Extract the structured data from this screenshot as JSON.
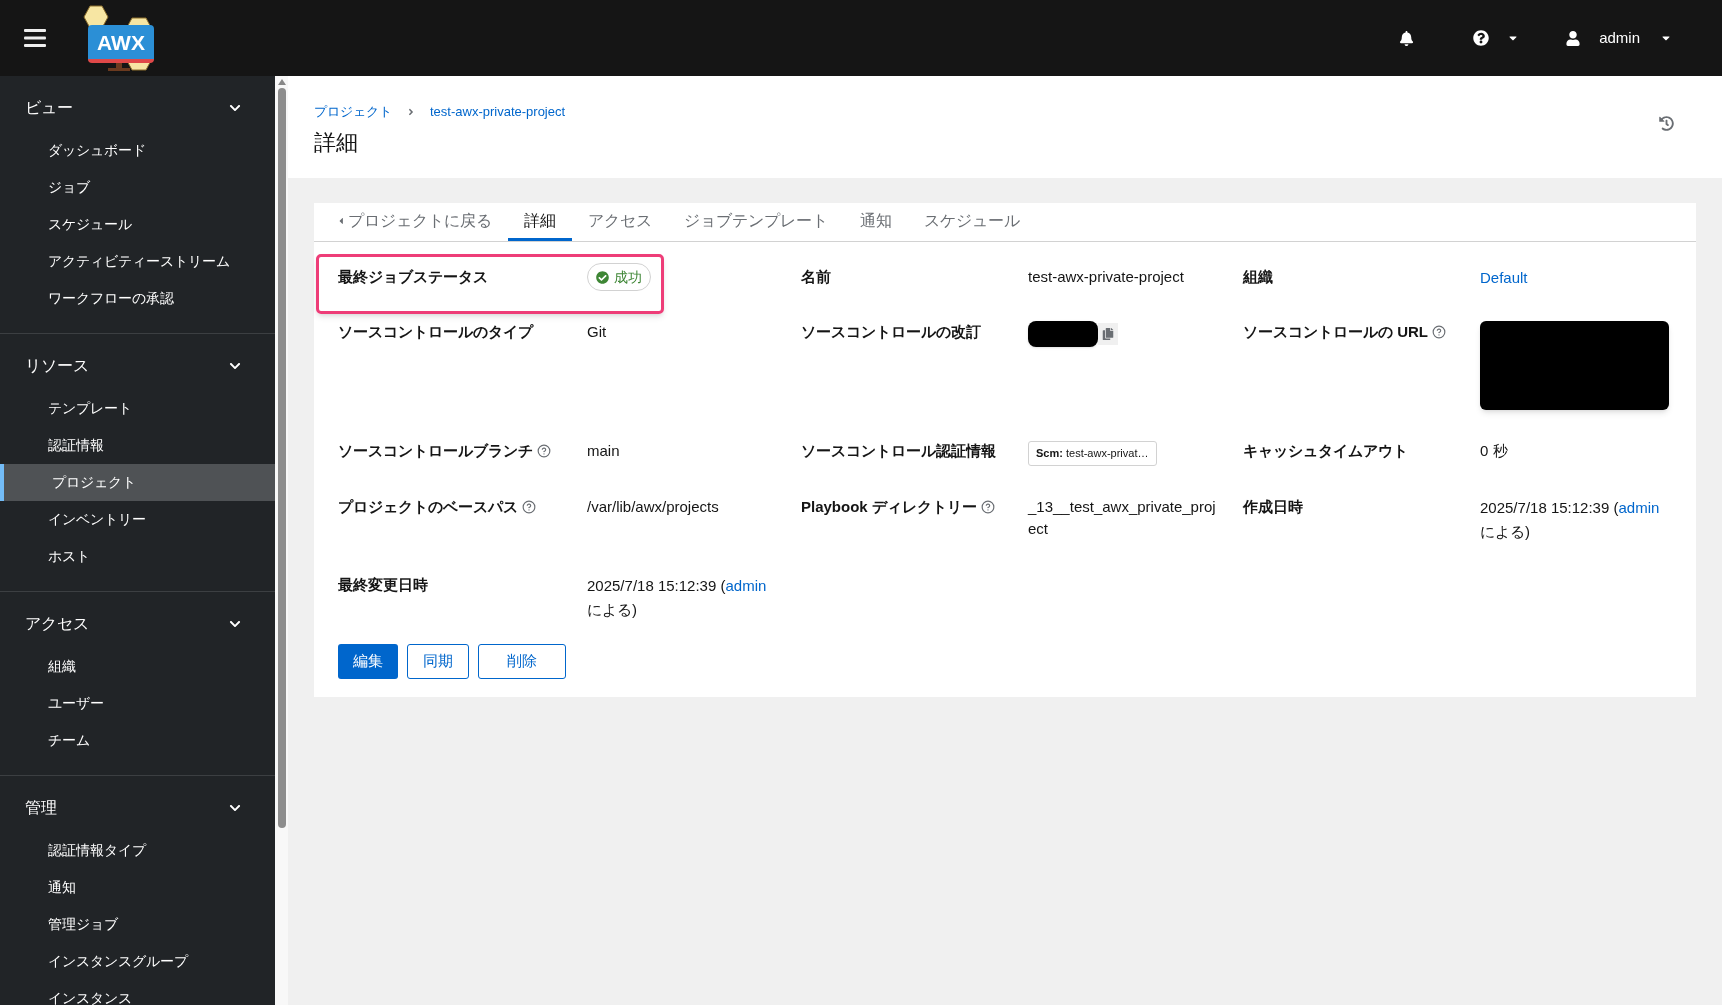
{
  "header": {
    "logo_text": "AWX",
    "user": "admin"
  },
  "sidebar": [
    {
      "title": "ビュー",
      "expanded": true,
      "items": [
        {
          "label": "ダッシュボード",
          "selected": false
        },
        {
          "label": "ジョブ",
          "selected": false
        },
        {
          "label": "スケジュール",
          "selected": false
        },
        {
          "label": "アクティビティーストリーム",
          "selected": false
        },
        {
          "label": "ワークフローの承認",
          "selected": false
        }
      ]
    },
    {
      "title": "リソース",
      "expanded": true,
      "items": [
        {
          "label": "テンプレート",
          "selected": false
        },
        {
          "label": "認証情報",
          "selected": false
        },
        {
          "label": "プロジェクト",
          "selected": true
        },
        {
          "label": "インベントリー",
          "selected": false
        },
        {
          "label": "ホスト",
          "selected": false
        }
      ]
    },
    {
      "title": "アクセス",
      "expanded": true,
      "items": [
        {
          "label": "組織",
          "selected": false
        },
        {
          "label": "ユーザー",
          "selected": false
        },
        {
          "label": "チーム",
          "selected": false
        }
      ]
    },
    {
      "title": "管理",
      "expanded": true,
      "items": [
        {
          "label": "認証情報タイプ",
          "selected": false
        },
        {
          "label": "通知",
          "selected": false
        },
        {
          "label": "管理ジョブ",
          "selected": false
        },
        {
          "label": "インスタンスグループ",
          "selected": false
        },
        {
          "label": "インスタンス",
          "selected": false
        }
      ]
    }
  ],
  "breadcrumb": [
    "プロジェクト",
    "test-awx-private-project"
  ],
  "page_title": "詳細",
  "tabs": [
    {
      "label": "プロジェクトに戻る",
      "kind": "back",
      "selected": false
    },
    {
      "label": "詳細",
      "kind": "tab",
      "selected": true
    },
    {
      "label": "アクセス",
      "kind": "tab",
      "selected": false
    },
    {
      "label": "ジョブテンプレート",
      "kind": "tab",
      "selected": false
    },
    {
      "label": "通知",
      "kind": "tab",
      "selected": false
    },
    {
      "label": "スケジュール",
      "kind": "tab",
      "selected": false
    }
  ],
  "details": [
    {
      "label": "最終ジョブステータス",
      "kind": "status",
      "value": "成功",
      "help": false,
      "highlighted": true
    },
    {
      "label": "名前",
      "kind": "text",
      "value": "test-awx-private-project",
      "help": false,
      "highlighted": false
    },
    {
      "label": "組織",
      "kind": "link",
      "value": "Default",
      "help": false,
      "highlighted": false
    },
    {
      "label": "ソースコントロールのタイプ",
      "kind": "text",
      "value": "Git",
      "help": false,
      "highlighted": false
    },
    {
      "label": "ソースコントロールの改訂",
      "kind": "redacted_copy",
      "help": false,
      "highlighted": false
    },
    {
      "label": "ソースコントロールの URL",
      "kind": "redacted",
      "help": true,
      "highlighted": false
    },
    {
      "label": "ソースコントロールブランチ",
      "kind": "text",
      "value": "main",
      "help": true,
      "highlighted": false
    },
    {
      "label": "ソースコントロール認証情報",
      "kind": "chip",
      "prefix": "Scm:",
      "value": "test-awx-privat…",
      "help": false,
      "highlighted": false
    },
    {
      "label": "キャッシュタイムアウト",
      "kind": "text",
      "value": "0 秒",
      "help": false,
      "highlighted": false
    },
    {
      "label": "プロジェクトのベースパス",
      "kind": "text",
      "value": "/var/lib/awx/projects",
      "help": true,
      "highlighted": false
    },
    {
      "label": "Playbook ディレクトリー",
      "kind": "text",
      "value": "_13__test_awx_private_project",
      "help": true,
      "highlighted": false
    },
    {
      "label": "作成日時",
      "kind": "by",
      "value": "2025/7/18 15:12:39 (",
      "link": "admin",
      "suffix": "による)",
      "help": false,
      "highlighted": false
    },
    {
      "label": "最終変更日時",
      "kind": "by",
      "value": "2025/7/18 15:12:39 (",
      "link": "admin",
      "suffix": "による)",
      "help": false,
      "highlighted": false
    }
  ],
  "buttons": [
    {
      "label": "編集",
      "kind": "primary"
    },
    {
      "label": "同期",
      "kind": "secondary"
    },
    {
      "label": "削除",
      "kind": "secondary"
    }
  ]
}
